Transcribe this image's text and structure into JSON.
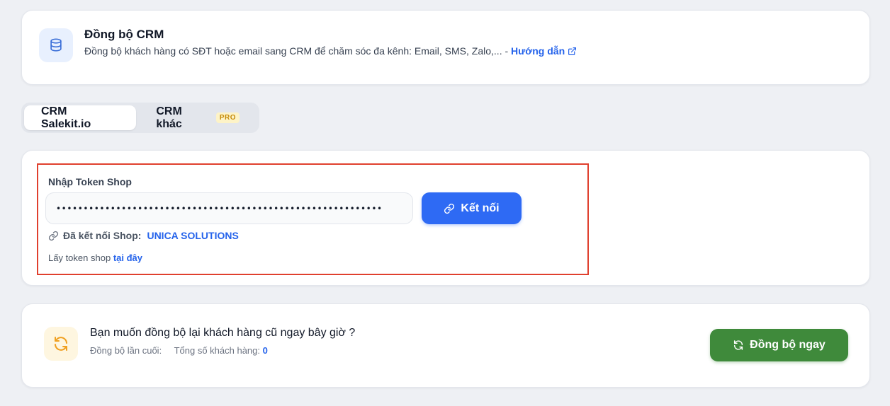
{
  "header": {
    "title": "Đồng bộ CRM",
    "description": "Đồng bộ khách hàng có SĐT hoặc email sang CRM để chăm sóc đa kênh: Email, SMS, Zalo,... -",
    "guide_link": "Hướng dẫn",
    "icon": "database-icon"
  },
  "tabs": [
    {
      "label": "CRM Salekit.io",
      "active": true
    },
    {
      "label": "CRM khác",
      "badge": "PRO",
      "active": false
    }
  ],
  "token": {
    "label": "Nhập Token Shop",
    "value": "••••••••••••••••••••••••••••••••••••••••••••••••••••••••••••",
    "connect_label": "Kết nối",
    "connected_label": "Đã kết nối Shop:",
    "shop_name": "UNICA SOLUTIONS",
    "get_token_text": "Lấy token shop",
    "get_token_link": "tại đây"
  },
  "sync": {
    "title": "Bạn muốn đồng bộ lại khách hàng cũ ngay bây giờ ?",
    "last_sync_label": "Đồng bộ lần cuối:",
    "total_label": "Tổng số khách hàng:",
    "total_value": "0",
    "button_label": "Đồng bộ ngay"
  },
  "colors": {
    "primary": "#2e6af4",
    "success": "#3f8a3b",
    "highlight_border": "#e0402e",
    "pro_badge": "#c58a09"
  }
}
